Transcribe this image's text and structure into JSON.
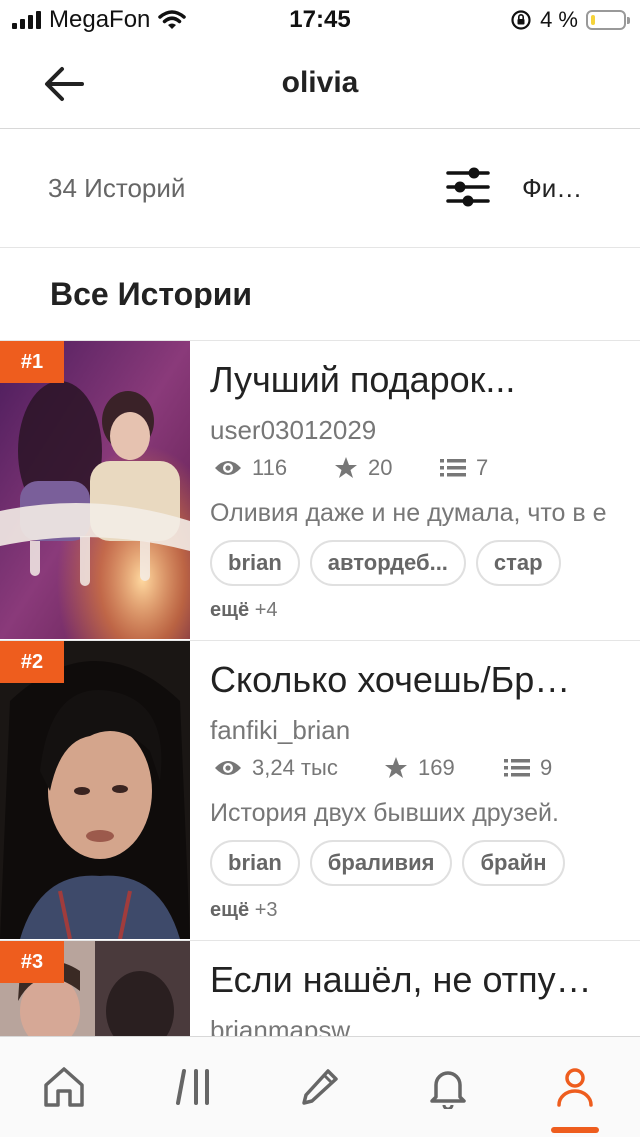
{
  "status_bar": {
    "carrier": "MegaFon",
    "time": "17:45",
    "battery": "4 %"
  },
  "header": {
    "title": "olivia"
  },
  "filter": {
    "count": "34 Историй",
    "label": "Фи…"
  },
  "section_title": "Все Истории",
  "stories": [
    {
      "rank": "#1",
      "title": "Лучший подарок...",
      "author": "user03012029",
      "reads": "116",
      "votes": "20",
      "parts": "7",
      "description": "Оливия даже и не думала, что в е",
      "tags": [
        "brian",
        "автордеб...",
        "стар"
      ],
      "more_label": "ещё",
      "more_count": "+4"
    },
    {
      "rank": "#2",
      "title": "Сколько хочешь/Бр…",
      "author": "fanfiki_brian",
      "reads": "3,24 тыс",
      "votes": "169",
      "parts": "9",
      "description": "История двух бывших друзей.",
      "tags": [
        "brian",
        "браливия",
        "брайн"
      ],
      "more_label": "ещё",
      "more_count": "+3"
    },
    {
      "rank": "#3",
      "title": "Если нашёл, не отпу…",
      "author": "brianmapsw"
    }
  ],
  "tabs": [
    "home-icon",
    "library-icon",
    "write-icon",
    "notifications-icon",
    "profile-icon"
  ],
  "colors": {
    "accent": "#ee5d1e",
    "text": "#222222",
    "muted": "#777777"
  }
}
